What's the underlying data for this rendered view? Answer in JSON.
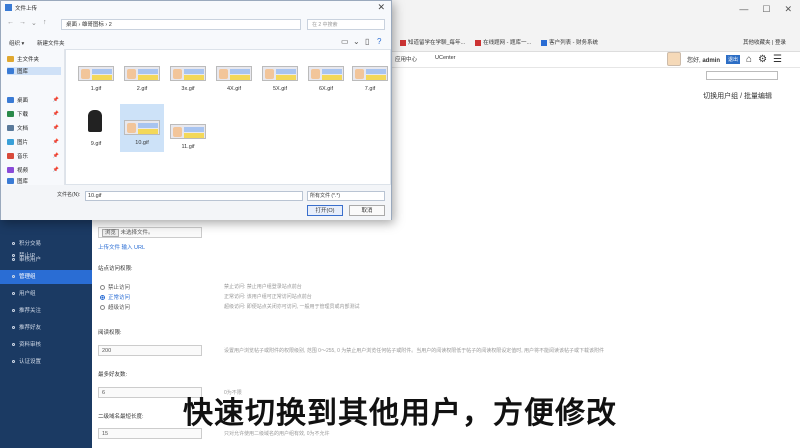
{
  "browser": {
    "bookmarks": [
      "知道留学在学聊_每年...",
      "在线题网 - 题库一...",
      "客户列表 - 财务系统"
    ],
    "bookmarks_right": "其他收藏夹 | 登录"
  },
  "header": {
    "nav": [
      "应用中心",
      "UCenter"
    ],
    "greeting": "您好, ",
    "username": "admin",
    "logout": "退出"
  },
  "page_title": "切换用户组 / 批量编辑",
  "dialog": {
    "title": "文件上传",
    "address": "桌面 › 雄哥图标 › 2",
    "search_placeholder": "在 2 中搜索",
    "toolbar_left": "组织 ▾",
    "toolbar_new_folder": "新建文件夹",
    "tree": [
      "主文件夹",
      "图库",
      "桌面",
      "下载",
      "文档",
      "图片",
      "音乐",
      "视频",
      "图库"
    ],
    "files": [
      "1.gif",
      "2.gif",
      "3x.gif",
      "4X.gif",
      "5X.gif",
      "6X.gif",
      "7.gif",
      "9.gif",
      "10.gif",
      "11.gif"
    ],
    "filename_label": "文件名(N):",
    "filename_value": "10.gif",
    "filetype": "所有文件 (*.*)",
    "open_label": "打开(O)",
    "cancel_label": "取消"
  },
  "sidebar": {
    "items": [
      "禁止IP",
      "积分交易",
      "审核用户",
      "管理组",
      "用户组",
      "推荐关注",
      "推荐好友",
      "资料审核",
      "认证设置"
    ],
    "active_index": 3
  },
  "form": {
    "browse_btn": "浏览",
    "no_file": "未选择文件。",
    "upload_links": "上传文件  输入 URL",
    "access_label": "站点访问权限:",
    "access_options": [
      "禁止访问",
      "正常访问",
      "超级访问"
    ],
    "access_selected": 1,
    "access_hints": [
      "禁止访问: 禁止用户组登录站点前台",
      "正常访问: 该用户组可正常访问站点前台",
      "超级访问: 即便站点关闭亦可访问, 一般用于管理员或内部测试"
    ],
    "credit_label": "阅读权限:",
    "credit_value": "200",
    "credit_hint": "设置用户浏览帖子或附件的权限级别, 范围 0～255, 0 为禁止用户浏览任何帖子或附件。当用户的阅读权限低于帖子的阅读权限设定值时, 用户将不能阅读该帖子或下载该附件",
    "friend_label": "最多好友数:",
    "friend_value": "6",
    "friend_hint": "0为不限",
    "post_label": "二级域名最短长度:",
    "post_value": "15",
    "post_hint": "只对允许使用二级域名的用户组有效, 0为不允许"
  },
  "subtitle": "快速切换到其他用户，方便修改"
}
